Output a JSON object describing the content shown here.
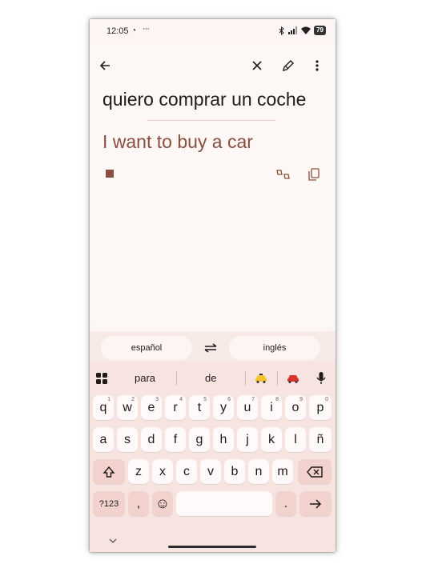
{
  "status_bar": {
    "time": "12:05",
    "whatsapp": "◔",
    "more_dots": "···",
    "battery": "79"
  },
  "translation": {
    "source": "quiero comprar un coche",
    "target": "I want to buy a car"
  },
  "languages": {
    "source": "español",
    "target": "inglés"
  },
  "suggestions": [
    "para",
    "de"
  ],
  "keyboard": {
    "row1": [
      {
        "k": "q",
        "s": "1"
      },
      {
        "k": "w",
        "s": "2"
      },
      {
        "k": "e",
        "s": "3"
      },
      {
        "k": "r",
        "s": "4"
      },
      {
        "k": "t",
        "s": "5"
      },
      {
        "k": "y",
        "s": "6"
      },
      {
        "k": "u",
        "s": "7"
      },
      {
        "k": "i",
        "s": "8"
      },
      {
        "k": "o",
        "s": "9"
      },
      {
        "k": "p",
        "s": "0"
      }
    ],
    "row2": [
      "a",
      "s",
      "d",
      "f",
      "g",
      "h",
      "j",
      "k",
      "l",
      "ñ"
    ],
    "row3": [
      "z",
      "x",
      "c",
      "v",
      "b",
      "n",
      "m"
    ],
    "symbols": "?123",
    "comma": ",",
    "period": ".",
    "emoji": "☺"
  },
  "colors": {
    "accent": "#8a4f3f",
    "background": "#fdf5f3",
    "keyboard": "#f7e4e1"
  },
  "icons": [
    "back-arrow-icon",
    "close-icon",
    "edit-pen-icon",
    "more-vert-icon",
    "feedback-icon",
    "copy-icon",
    "swap-icon",
    "apps-grid-icon",
    "taxi-emoji-icon",
    "car-emoji-icon",
    "mic-icon",
    "shift-icon",
    "backspace-icon",
    "enter-icon",
    "chevron-down-icon"
  ]
}
